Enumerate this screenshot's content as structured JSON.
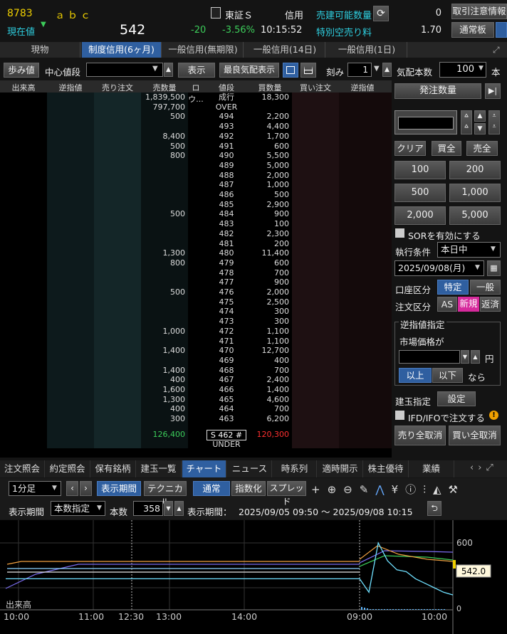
{
  "header": {
    "code": "8783",
    "name": "ａｂｃ",
    "current_label": "現在値",
    "price": "542",
    "change": "-20",
    "change_pct": "-3.56%",
    "time": "10:15:52",
    "exchange": "東証Ｓ",
    "credit_label": "信用",
    "sellable_label": "売建可能数量",
    "sellable_value": "0",
    "special_fee_label": "特別空売り料",
    "special_fee_value": "1.70",
    "caution_button": "取引注意情報",
    "board_button": "通常板"
  },
  "tabs": [
    "現物",
    "制度信用(6ヶ月)",
    "一般信用(無期限)",
    "一般信用(14日)",
    "一般信用(1日)"
  ],
  "toolbar": {
    "ayumi": "歩み値",
    "center_label": "中心値段",
    "show": "表示",
    "best_quote": "最良気配表示",
    "tick_label": "刻み",
    "tick_value": "1",
    "quote_count_label": "気配本数",
    "quote_count_value": "100",
    "unit": "本"
  },
  "board": {
    "headers": [
      "出来高",
      "逆指値",
      "売り注文",
      "売数量",
      "ロウ...",
      "値段",
      "買数量",
      "買い注文",
      "逆指値"
    ],
    "rows": [
      [
        "",
        "",
        "",
        "1,839,500",
        "",
        "成行",
        "18,300"
      ],
      [
        "",
        "",
        "",
        "797,700",
        "",
        "OVER",
        ""
      ],
      [
        "",
        "",
        "",
        "500",
        "",
        "494",
        "2,200"
      ],
      [
        "",
        "",
        "",
        "",
        "",
        "493",
        "4,400"
      ],
      [
        "",
        "",
        "",
        "8,400",
        "",
        "492",
        "1,700"
      ],
      [
        "",
        "",
        "",
        "500",
        "",
        "491",
        "600"
      ],
      [
        "",
        "",
        "",
        "800",
        "",
        "490",
        "5,500"
      ],
      [
        "",
        "",
        "",
        "",
        "",
        "489",
        "5,000"
      ],
      [
        "",
        "",
        "",
        "",
        "",
        "488",
        "2,000"
      ],
      [
        "",
        "",
        "",
        "",
        "",
        "487",
        "1,000"
      ],
      [
        "",
        "",
        "",
        "",
        "",
        "486",
        "500"
      ],
      [
        "",
        "",
        "",
        "",
        "",
        "485",
        "2,900"
      ],
      [
        "",
        "",
        "",
        "500",
        "",
        "484",
        "900"
      ],
      [
        "",
        "",
        "",
        "",
        "",
        "483",
        "100"
      ],
      [
        "",
        "",
        "",
        "",
        "",
        "482",
        "2,300"
      ],
      [
        "",
        "",
        "",
        "",
        "",
        "481",
        "200"
      ],
      [
        "",
        "",
        "",
        "1,300",
        "",
        "480",
        "11,400"
      ],
      [
        "",
        "",
        "",
        "800",
        "",
        "479",
        "600"
      ],
      [
        "",
        "",
        "",
        "",
        "",
        "478",
        "700"
      ],
      [
        "",
        "",
        "",
        "",
        "",
        "477",
        "900"
      ],
      [
        "",
        "",
        "",
        "500",
        "",
        "476",
        "2,000"
      ],
      [
        "",
        "",
        "",
        "",
        "",
        "475",
        "2,500"
      ],
      [
        "",
        "",
        "",
        "",
        "",
        "474",
        "300"
      ],
      [
        "",
        "",
        "",
        "",
        "",
        "473",
        "300"
      ],
      [
        "",
        "",
        "",
        "1,000",
        "",
        "472",
        "1,100"
      ],
      [
        "",
        "",
        "",
        "",
        "",
        "471",
        "1,100"
      ],
      [
        "",
        "",
        "",
        "1,400",
        "",
        "470",
        "12,700"
      ],
      [
        "",
        "",
        "",
        "",
        "",
        "469",
        "400"
      ],
      [
        "",
        "",
        "",
        "1,400",
        "",
        "468",
        "700"
      ],
      [
        "",
        "",
        "",
        "400",
        "",
        "467",
        "2,400"
      ],
      [
        "",
        "",
        "",
        "1,600",
        "",
        "466",
        "1,400"
      ],
      [
        "",
        "",
        "",
        "1,300",
        "",
        "465",
        "4,600"
      ],
      [
        "",
        "",
        "",
        "400",
        "",
        "464",
        "700"
      ],
      [
        "",
        "",
        "",
        "300",
        "",
        "463",
        "6,200"
      ]
    ],
    "total_sell": "126,400",
    "current_mark": "S  462  #",
    "total_buy": "120,300",
    "under": "UNDER"
  },
  "order": {
    "qty_button": "発注数量",
    "clear": "クリア",
    "buy_all": "買全",
    "sell_all": "売全",
    "qty_presets": [
      "100",
      "200",
      "500",
      "1,000",
      "2,000",
      "5,000"
    ],
    "sor_label": "SORを有効にする",
    "exec_label": "執行条件",
    "exec_value": "本日中",
    "date_value": "2025/09/08(月)",
    "account_label": "口座区分",
    "account_specific": "特定",
    "account_general": "一般",
    "order_type_label": "注文区分",
    "order_as": "AS",
    "order_new": "新規",
    "order_close": "返済",
    "stop_title": "逆指値指定",
    "market_price": "市場価格が",
    "yen": "円",
    "above": "以上",
    "below": "以下",
    "then": "なら",
    "position_label": "建玉指定",
    "setting": "設定",
    "ifd_label": "IFD/IFOで注文する",
    "cancel_sell": "売り全取消",
    "cancel_buy": "買い全取消"
  },
  "bottom_tabs": [
    "注文照会",
    "約定照会",
    "保有銘柄",
    "建玉一覧",
    "チャート",
    "ニュース",
    "時系列",
    "適時開示",
    "株主優待",
    "業績"
  ],
  "chart_toolbar": {
    "interval": "1分足",
    "period_btn": "表示期間",
    "technical": "テクニカル",
    "normal": "通常",
    "index": "指数化",
    "spread": "スプレッド",
    "period_label": "表示期間",
    "period_mode": "本数指定",
    "count_label": "本数",
    "count_value": "358",
    "range_label": "表示期間：",
    "range_value": "2025/09/05 09:50 ～ 2025/09/08 10:15"
  },
  "chart_data": {
    "type": "line",
    "x_ticks": [
      "10:00",
      "11:00",
      "12:30",
      "13:00",
      "14:00",
      "09:00",
      "10:00"
    ],
    "y_ticks": [
      "600"
    ],
    "last_price": "542.0",
    "volume_label": "出来高",
    "volume_tick": "0",
    "series": [
      {
        "values": [
          560,
          560,
          560,
          560,
          560,
          560,
          560,
          560,
          560,
          560,
          560,
          560,
          545,
          600,
          580,
          570,
          568,
          560,
          555,
          550,
          545,
          542
        ]
      }
    ]
  },
  "colors": {
    "accent": "#2f5fa0",
    "up": "#3ccd5a",
    "down_total": "#ff3030"
  }
}
